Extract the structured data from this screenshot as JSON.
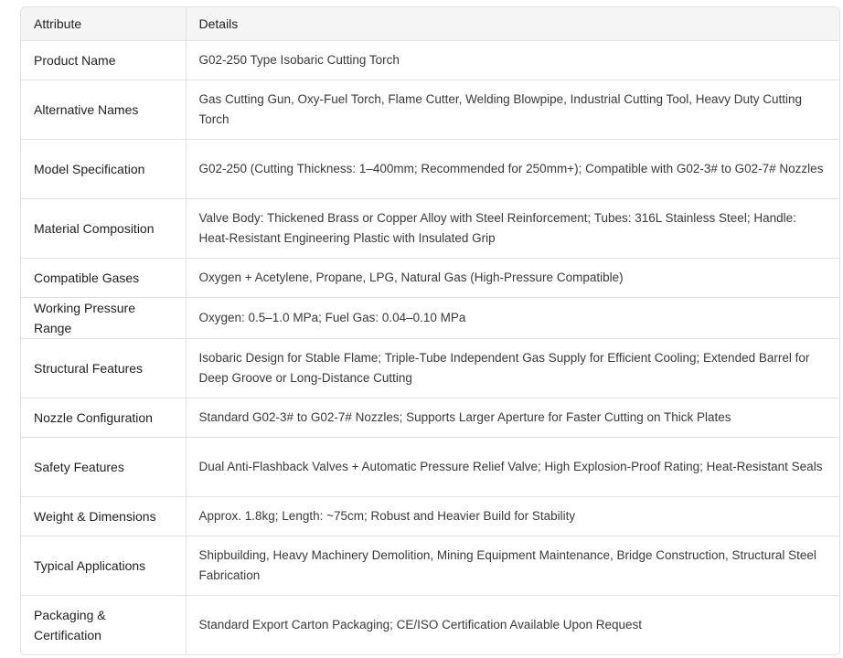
{
  "table": {
    "headers": [
      "Attribute",
      "Details"
    ],
    "rows": [
      {
        "attribute": "Product Name",
        "details": "G02-250 Type Isobaric Cutting Torch"
      },
      {
        "attribute": "Alternative Names",
        "details": "Gas Cutting Gun, Oxy-Fuel Torch, Flame Cutter, Welding Blowpipe, Industrial Cutting Tool, Heavy Duty Cutting Torch"
      },
      {
        "attribute": "Model Specification",
        "details": "G02-250 (Cutting Thickness: 1–400mm; Recommended for 250mm+); Compatible with G02-3# to G02-7# Nozzles"
      },
      {
        "attribute": "Material Composition",
        "details": "Valve Body: Thickened Brass or Copper Alloy with Steel Reinforcement; Tubes: 316L Stainless Steel; Handle: Heat-Resistant Engineering Plastic with Insulated Grip"
      },
      {
        "attribute": "Compatible Gases",
        "details": "Oxygen + Acetylene, Propane, LPG, Natural Gas (High-Pressure Compatible)"
      },
      {
        "attribute": "Working Pressure Range",
        "details": "Oxygen: 0.5–1.0 MPa; Fuel Gas: 0.04–0.10 MPa"
      },
      {
        "attribute": "Structural Features",
        "details": "Isobaric Design for Stable Flame; Triple-Tube Independent Gas Supply for Efficient Cooling; Extended Barrel for Deep Groove or Long-Distance Cutting"
      },
      {
        "attribute": "Nozzle Configuration",
        "details": "Standard G02-3# to G02-7# Nozzles; Supports Larger Aperture for Faster Cutting on Thick Plates"
      },
      {
        "attribute": "Safety Features",
        "details": "Dual Anti-Flashback Valves + Automatic Pressure Relief Valve; High Explosion-Proof Rating; Heat-Resistant Seals"
      },
      {
        "attribute": "Weight & Dimensions",
        "details": "Approx. 1.8kg; Length: ~75cm; Robust and Heavier Build for Stability"
      },
      {
        "attribute": "Typical Applications",
        "details": "Shipbuilding, Heavy Machinery Demolition, Mining Equipment Maintenance, Bridge Construction, Structural Steel Fabrication"
      },
      {
        "attribute": "Packaging & Certification",
        "details": "Standard Export Carton Packaging; CE/ISO Certification Available Upon Request"
      }
    ]
  }
}
